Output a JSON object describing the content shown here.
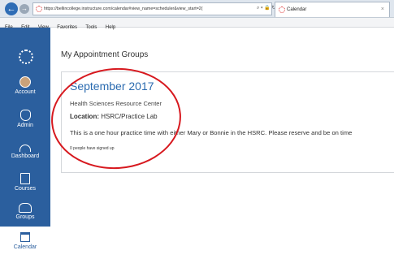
{
  "browser": {
    "url": "https://bellincollege.instructure.com/calendar#view_name=scheduler&view_start=2(",
    "address_icons": "⌕ ▾ 🔒 ↻",
    "tab_title": "Calendar",
    "tab_close": "×",
    "menu": [
      "File",
      "Edit",
      "View",
      "Favorites",
      "Tools",
      "Help"
    ]
  },
  "sidebar": {
    "items": [
      {
        "label": "Account",
        "icon": "avatar-icon"
      },
      {
        "label": "Admin",
        "icon": "shield-icon"
      },
      {
        "label": "Dashboard",
        "icon": "dashboard-icon"
      },
      {
        "label": "Courses",
        "icon": "book-icon"
      },
      {
        "label": "Groups",
        "icon": "groups-icon"
      },
      {
        "label": "Calendar",
        "icon": "calendar-icon"
      }
    ],
    "color": "#2b5f9e"
  },
  "main": {
    "page_title": "My Appointment Groups",
    "group": {
      "month": "September 2017",
      "resource": "Health Sciences Resource Center",
      "location_label": "Location:",
      "location_value": "HSRC/Practice Lab",
      "description": "This is a one hour practice time with either Mary or Bonnie in the HSRC. Please reserve and be on time",
      "signed_up": "0 people have signed up"
    },
    "highlight_color": "#d7191f"
  }
}
